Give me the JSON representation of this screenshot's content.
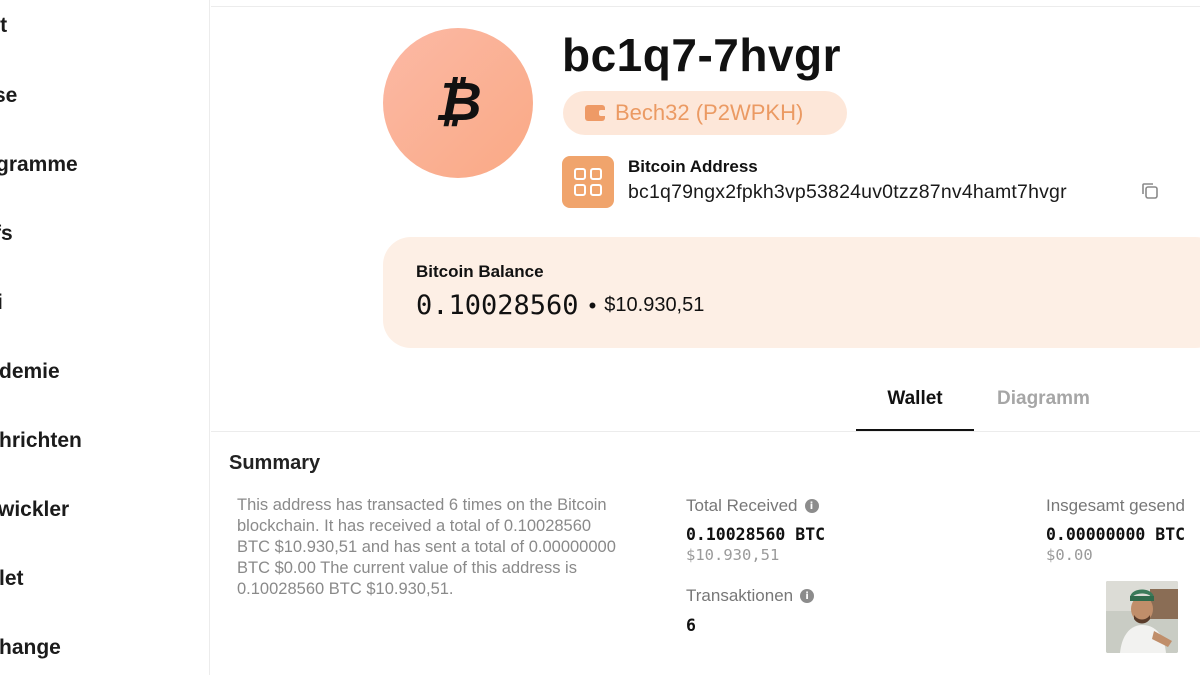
{
  "sidebar": {
    "items": [
      {
        "label": "rt"
      },
      {
        "label": "se"
      },
      {
        "label": "gramme"
      },
      {
        "label": "fs"
      },
      {
        "label": "i"
      },
      {
        "label": "demie"
      },
      {
        "label": "hrichten"
      },
      {
        "label": "wickler"
      },
      {
        "label": "let"
      },
      {
        "label": "hange"
      }
    ]
  },
  "header": {
    "coin_icon": "bitcoin-icon",
    "coin_symbol": "₿",
    "address_short": "bc1q7-7hvgr",
    "address_type": "Bech32 (P2WPKH)",
    "address_type_icon": "wallet-icon",
    "qr_icon": "qr-code-icon",
    "address_label": "Bitcoin Address",
    "address_full": "bc1q79ngx2fpkh3vp53824uv0tzz87nv4hamt7hvgr",
    "copy_icon": "copy-icon"
  },
  "balance": {
    "label": "Bitcoin Balance",
    "btc": "0.10028560",
    "separator": "•",
    "fiat": "$10.930,51"
  },
  "tabs": [
    {
      "label": "Wallet",
      "active": true
    },
    {
      "label": "Diagramm",
      "active": false
    }
  ],
  "summary": {
    "title": "Summary",
    "description": "This address has transacted 6 times on the Bitcoin blockchain. It has received a total of 0.10028560 BTC $10.930,51 and has sent a total of 0.00000000 BTC $0.00 The current value of this address is 0.10028560 BTC $10.930,51.",
    "total_received": {
      "label": "Total Received",
      "btc": "0.10028560 BTC",
      "fiat": "$10.930,51"
    },
    "total_sent": {
      "label": "Insgesamt gesend",
      "btc": "0.00000000 BTC",
      "fiat": "$0.00"
    },
    "transactions": {
      "label": "Transaktionen",
      "value": "6"
    },
    "info_icon": "info-icon",
    "info_glyph": "i"
  },
  "colors": {
    "accent": "#f0a46c",
    "badge_bg": "#fde7d9",
    "badge_text": "#eb9a63",
    "balance_bg": "#fdefe5",
    "avatar_gradient": "#fcb9a5"
  }
}
